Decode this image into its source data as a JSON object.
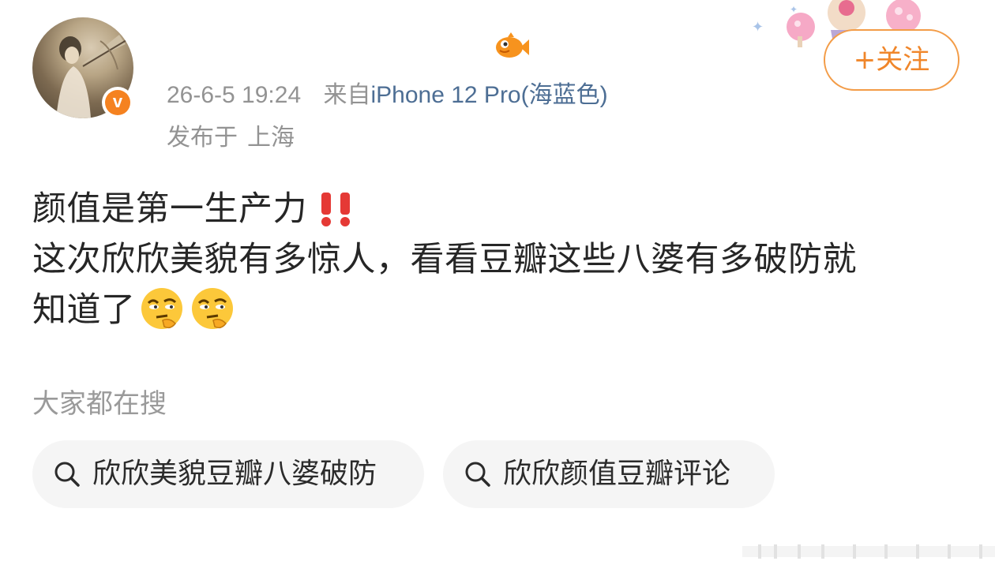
{
  "user": {
    "username": "",
    "avatar_description": "avatar",
    "verified": true,
    "verified_letter": "v"
  },
  "post": {
    "timestamp": "26-6-5 19:24",
    "source_prefix": "来自",
    "source_device": "iPhone 12 Pro(海蓝色)",
    "location_prefix": "发布于",
    "location": "上海",
    "lines": [
      "颜值是第一生产力",
      "这次欣欣美貌有多惊人，看看豆瓣这些八婆有多破防就",
      "知道了"
    ]
  },
  "follow_button": {
    "label": "+关注"
  },
  "search_section": {
    "title": "大家都在搜",
    "chips": [
      "欣欣美貌豆瓣八婆破防",
      "欣欣颜值豆瓣评论"
    ]
  },
  "colors": {
    "accent": "#f0862a",
    "link": "#4d6e94",
    "meta": "#939393",
    "text": "#262626",
    "chip_bg": "#f5f5f5"
  },
  "icons": {
    "emphasis": "double-exclamation-icon",
    "emoji": "thinking-face-emoji-icon",
    "search": "search-icon",
    "fish": "fish-emoji-icon"
  }
}
